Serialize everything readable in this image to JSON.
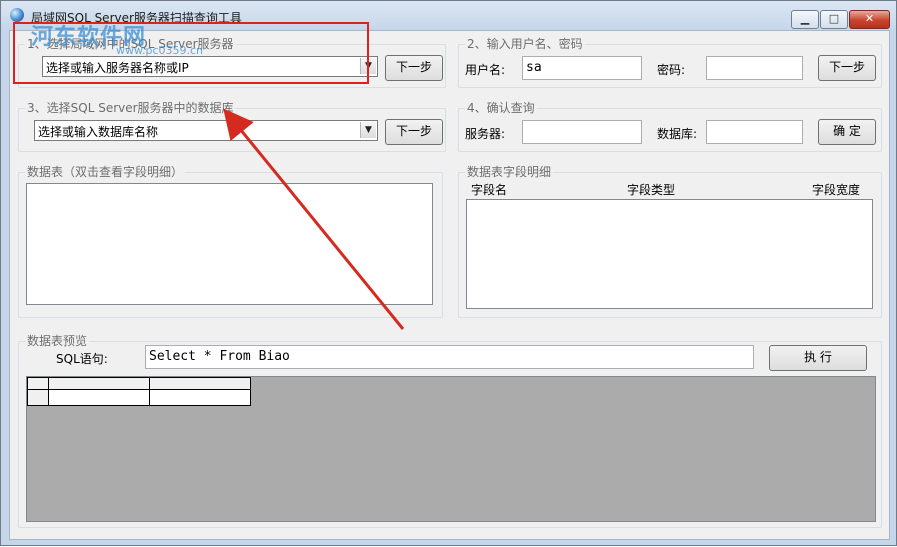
{
  "window": {
    "title": "局域网SQL Server服务器扫描查询工具",
    "minimize_glyph": "▁",
    "maximize_glyph": "□",
    "close_glyph": "✕"
  },
  "group1": {
    "legend": "1、选择局域网中的SQL Server服务器",
    "combo_text": "选择或输入服务器名称或IP",
    "next_label": "下一步"
  },
  "group2": {
    "legend": "2、输入用户名、密码",
    "username_label": "用户名:",
    "username_value": "sa",
    "password_label": "密码:",
    "password_value": "",
    "next_label": "下一步"
  },
  "group3": {
    "legend": "3、选择SQL Server服务器中的数据库",
    "combo_text": "选择或输入数据库名称",
    "next_label": "下一步"
  },
  "group4": {
    "legend": "4、确认查询",
    "server_label": "服务器:",
    "server_value": "",
    "database_label": "数据库:",
    "database_value": "",
    "confirm_label": "确 定"
  },
  "tables_group": {
    "legend": "数据表（双击查看字段明细）"
  },
  "fields_group": {
    "legend": "数据表字段明细",
    "columns": [
      "字段名",
      "字段类型",
      "字段宽度"
    ]
  },
  "preview_group": {
    "legend": "数据表预览",
    "sql_label": "SQL语句:",
    "sql_value": "Select * From Biao",
    "execute_label": "执 行"
  },
  "watermark": {
    "text": "河东软件网",
    "sub": "www.pc0359.cn"
  },
  "colors": {
    "highlight": "#e0201c",
    "arrow": "#d42a20",
    "titlebar": "#c5d6ea",
    "close_button": "#c8442e"
  }
}
